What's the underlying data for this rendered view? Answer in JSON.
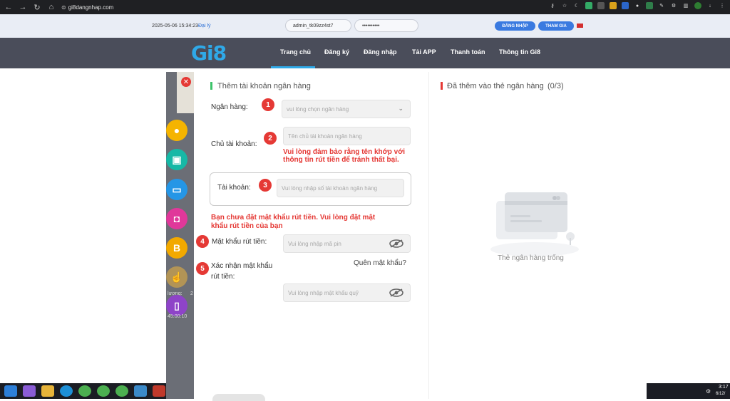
{
  "browser": {
    "url": "gi8dangnhap.com"
  },
  "login_strip": {
    "datetime": "2025-05-06 15:34:23",
    "agent_link": "Đại lý",
    "username_value": "admin_tk09zz4st7",
    "password_value": "••••••••••",
    "login_button": "ĐĂNG NHẬP",
    "join_button": "THAM GIA"
  },
  "nav": {
    "logo": "Gi8",
    "items": [
      "Trang chủ",
      "Đăng ký",
      "Đăng nhập",
      "Tải APP",
      "Thanh toán",
      "Thông tin Gi8"
    ]
  },
  "sidebar": {
    "text1": "lượng:",
    "text1_num": "2",
    "text2": "45:00:10"
  },
  "form": {
    "title": "Thêm tài khoản ngân hàng",
    "bank_label": "Ngân hàng:",
    "bank_placeholder": "vui lòng chọn ngân hàng",
    "holder_label": "Chủ tài khoản:",
    "holder_placeholder": "Tên chủ tài khoản ngân hàng",
    "holder_warning_1": "Vui lòng đảm bảo rằng tên khớp với",
    "holder_warning_2": "thông tin rút tiền để tránh thất bại.",
    "account_label": "Tài khoản:",
    "account_placeholder": "Vui lòng nhập số tài khoản ngân hàng",
    "pin_warning_1": "Bạn chưa đặt mật khẩu rút tiền. Vui lòng đặt mật",
    "pin_warning_2": "khẩu rút tiền của bạn",
    "pin_label": "Mật khẩu rút tiền:",
    "pin_placeholder": "Vui lòng nhập mã pin",
    "confirm_label_1": "Xác nhận mật khẩu",
    "confirm_label_2": "rút tiền:",
    "forgot_link": "Quên mật khẩu?",
    "confirm_placeholder": "Vui lòng nhập mật khẩu quỹ",
    "badges": [
      "1",
      "2",
      "3",
      "4",
      "5"
    ]
  },
  "right_panel": {
    "title": "Đã thêm vào thẻ ngân hàng",
    "count": "(0/3)",
    "empty_text": "Thẻ ngân hàng trống"
  },
  "taskbar": {
    "time": "3:17",
    "date": "6/12/"
  },
  "colors": {
    "accent_blue": "#2fa9e8",
    "badge_red": "#e53935",
    "nav_bg": "#4a4d5a",
    "title_green": "#3cc36a"
  }
}
